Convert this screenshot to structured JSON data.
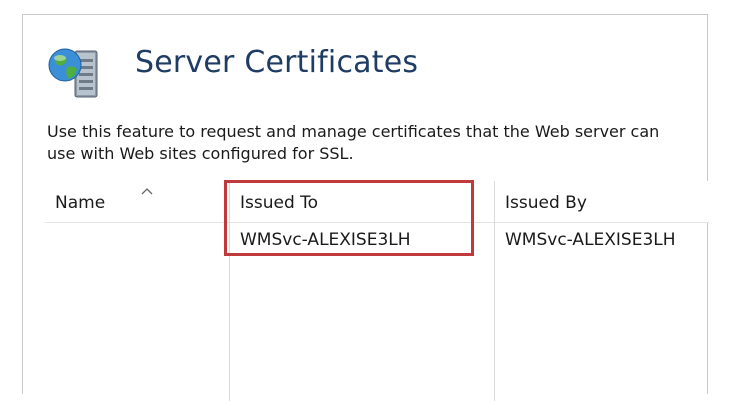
{
  "header": {
    "title": "Server Certificates",
    "icon": "server-globe-icon"
  },
  "description": "Use this feature to request and manage certificates that the Web server can use with Web sites configured for SSL.",
  "table": {
    "columns": [
      "Name",
      "Issued To",
      "Issued By"
    ],
    "sort_column": "Name",
    "sort_direction": "ascending",
    "rows": [
      {
        "name": "",
        "issued_to": "WMSvc-ALEXISE3LH",
        "issued_by": "WMSvc-ALEXISE3LH"
      }
    ]
  },
  "annotation": {
    "highlight_color": "#c0393b",
    "highlighted_column": "Issued To"
  }
}
